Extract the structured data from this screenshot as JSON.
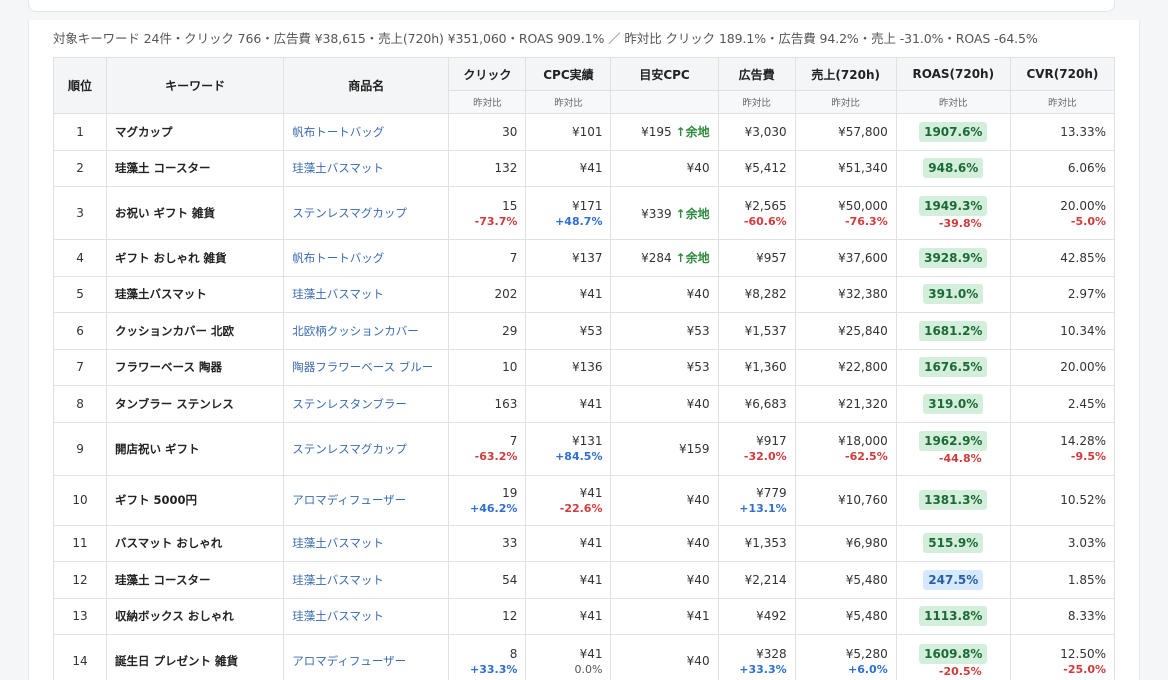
{
  "summary": "対象キーワード 24件・クリック 766・広告費 ¥38,615・売上(720h) ¥351,060・ROAS 909.1% ／ 昨対比 クリック 189.1%・広告費 94.2%・売上 -31.0%・ROAS -64.5%",
  "table": {
    "headers": [
      "順位",
      "キーワード",
      "商品名",
      "クリック",
      "CPC実績",
      "目安CPC",
      "広告費",
      "売上(720h)",
      "ROAS(720h)",
      "CVR(720h)"
    ],
    "subheaders": [
      "",
      "",
      "",
      "昨対比",
      "昨対比",
      "",
      "昨対比",
      "昨対比",
      "昨対比",
      "昨対比"
    ],
    "rows": [
      {
        "rank": "1",
        "keyword": "マグカップ",
        "product": "帆布トートバッグ",
        "clicks": "30",
        "clicks_d": "",
        "cpc": "¥101",
        "cpc_d": "",
        "target_cpc": "¥195",
        "target_note": "余地",
        "cost": "¥3,030",
        "cost_d": "",
        "sales": "¥57,800",
        "sales_d": "",
        "roas": "1907.6%",
        "roas_d": "",
        "cvr": "13.33%",
        "cvr_d": ""
      },
      {
        "rank": "2",
        "keyword": "珪藻土 コースター",
        "product": "珪藻土バスマット",
        "clicks": "132",
        "clicks_d": "",
        "cpc": "¥41",
        "cpc_d": "",
        "target_cpc": "¥40",
        "target_note": "",
        "cost": "¥5,412",
        "cost_d": "",
        "sales": "¥51,340",
        "sales_d": "",
        "roas": "948.6%",
        "roas_d": "",
        "cvr": "6.06%",
        "cvr_d": ""
      },
      {
        "rank": "3",
        "keyword": "お祝い ギフト 雑貨",
        "product": "ステンレスマグカップ",
        "clicks": "15",
        "clicks_d": "-73.7%",
        "cpc": "¥171",
        "cpc_d": "+48.7%",
        "target_cpc": "¥339",
        "target_note": "余地",
        "cost": "¥2,565",
        "cost_d": "-60.6%",
        "sales": "¥50,000",
        "sales_d": "-76.3%",
        "roas": "1949.3%",
        "roas_d": "-39.8%",
        "cvr": "20.00%",
        "cvr_d": "-5.0%"
      },
      {
        "rank": "4",
        "keyword": "ギフト おしゃれ 雑貨",
        "product": "帆布トートバッグ",
        "clicks": "7",
        "clicks_d": "",
        "cpc": "¥137",
        "cpc_d": "",
        "target_cpc": "¥284",
        "target_note": "余地",
        "cost": "¥957",
        "cost_d": "",
        "sales": "¥37,600",
        "sales_d": "",
        "roas": "3928.9%",
        "roas_d": "",
        "cvr": "42.85%",
        "cvr_d": ""
      },
      {
        "rank": "5",
        "keyword": "珪藻土バスマット",
        "product": "珪藻土バスマット",
        "clicks": "202",
        "clicks_d": "",
        "cpc": "¥41",
        "cpc_d": "",
        "target_cpc": "¥40",
        "target_note": "",
        "cost": "¥8,282",
        "cost_d": "",
        "sales": "¥32,380",
        "sales_d": "",
        "roas": "391.0%",
        "roas_d": "",
        "cvr": "2.97%",
        "cvr_d": ""
      },
      {
        "rank": "6",
        "keyword": "クッションカバー 北欧",
        "product": "北欧柄クッションカバー",
        "clicks": "29",
        "clicks_d": "",
        "cpc": "¥53",
        "cpc_d": "",
        "target_cpc": "¥53",
        "target_note": "",
        "cost": "¥1,537",
        "cost_d": "",
        "sales": "¥25,840",
        "sales_d": "",
        "roas": "1681.2%",
        "roas_d": "",
        "cvr": "10.34%",
        "cvr_d": ""
      },
      {
        "rank": "7",
        "keyword": "フラワーベース 陶器",
        "product": "陶器フラワーベース ブルー",
        "clicks": "10",
        "clicks_d": "",
        "cpc": "¥136",
        "cpc_d": "",
        "target_cpc": "¥53",
        "target_note": "",
        "cost": "¥1,360",
        "cost_d": "",
        "sales": "¥22,800",
        "sales_d": "",
        "roas": "1676.5%",
        "roas_d": "",
        "cvr": "20.00%",
        "cvr_d": ""
      },
      {
        "rank": "8",
        "keyword": "タンブラー ステンレス",
        "product": "ステンレスタンブラー",
        "clicks": "163",
        "clicks_d": "",
        "cpc": "¥41",
        "cpc_d": "",
        "target_cpc": "¥40",
        "target_note": "",
        "cost": "¥6,683",
        "cost_d": "",
        "sales": "¥21,320",
        "sales_d": "",
        "roas": "319.0%",
        "roas_d": "",
        "cvr": "2.45%",
        "cvr_d": ""
      },
      {
        "rank": "9",
        "keyword": "開店祝い ギフト",
        "product": "ステンレスマグカップ",
        "clicks": "7",
        "clicks_d": "-63.2%",
        "cpc": "¥131",
        "cpc_d": "+84.5%",
        "target_cpc": "¥159",
        "target_note": "",
        "cost": "¥917",
        "cost_d": "-32.0%",
        "sales": "¥18,000",
        "sales_d": "-62.5%",
        "roas": "1962.9%",
        "roas_d": "-44.8%",
        "cvr": "14.28%",
        "cvr_d": "-9.5%"
      },
      {
        "rank": "10",
        "keyword": "ギフト 5000円",
        "product": "アロマディフューザー",
        "clicks": "19",
        "clicks_d": "+46.2%",
        "cpc": "¥41",
        "cpc_d": "-22.6%",
        "target_cpc": "¥40",
        "target_note": "",
        "cost": "¥779",
        "cost_d": "+13.1%",
        "sales": "¥10,760",
        "sales_d": "",
        "roas": "1381.3%",
        "roas_d": "",
        "cvr": "10.52%",
        "cvr_d": ""
      },
      {
        "rank": "11",
        "keyword": "バスマット おしゃれ",
        "product": "珪藻土バスマット",
        "clicks": "33",
        "clicks_d": "",
        "cpc": "¥41",
        "cpc_d": "",
        "target_cpc": "¥40",
        "target_note": "",
        "cost": "¥1,353",
        "cost_d": "",
        "sales": "¥6,980",
        "sales_d": "",
        "roas": "515.9%",
        "roas_d": "",
        "cvr": "3.03%",
        "cvr_d": ""
      },
      {
        "rank": "12",
        "keyword": "珪藻土 コースター",
        "product": "珪藻土バスマット",
        "clicks": "54",
        "clicks_d": "",
        "cpc": "¥41",
        "cpc_d": "",
        "target_cpc": "¥40",
        "target_note": "",
        "cost": "¥2,214",
        "cost_d": "",
        "sales": "¥5,480",
        "sales_d": "",
        "roas": "247.5%",
        "roas_d": "",
        "cvr": "1.85%",
        "cvr_d": "",
        "roas_style": "blue"
      },
      {
        "rank": "13",
        "keyword": "収納ボックス おしゃれ",
        "product": "珪藻土バスマット",
        "clicks": "12",
        "clicks_d": "",
        "cpc": "¥41",
        "cpc_d": "",
        "target_cpc": "¥41",
        "target_note": "",
        "cost": "¥492",
        "cost_d": "",
        "sales": "¥5,480",
        "sales_d": "",
        "roas": "1113.8%",
        "roas_d": "",
        "cvr": "8.33%",
        "cvr_d": ""
      },
      {
        "rank": "14",
        "keyword": "誕生日 プレゼント 雑貨",
        "product": "アロマディフューザー",
        "clicks": "8",
        "clicks_d": "+33.3%",
        "cpc": "¥41",
        "cpc_d": "0.0%",
        "target_cpc": "¥40",
        "target_note": "",
        "cost": "¥328",
        "cost_d": "+33.3%",
        "sales": "¥5,280",
        "sales_d": "+6.0%",
        "roas": "1609.8%",
        "roas_d": "-20.5%",
        "cvr": "12.50%",
        "cvr_d": "-25.0%"
      }
    ]
  },
  "colors": {
    "negative": "#d23b3b",
    "positive": "#2f6fd1",
    "roas_good": "#d3eedb",
    "roas_low": "#d6e8fb",
    "link": "#3a6bb3"
  },
  "icons": {
    "target_up": "arrow-up-icon"
  }
}
